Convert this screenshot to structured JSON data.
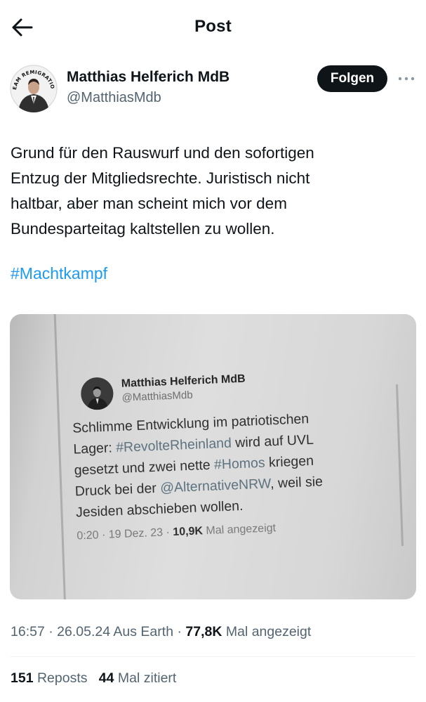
{
  "header": {
    "title": "Post"
  },
  "author": {
    "name": "Matthias Helferich MdB",
    "handle": "@MatthiasMdb",
    "avatar_badge_text": "TEAM REMIGRATION"
  },
  "follow_button": {
    "label": "Folgen"
  },
  "post": {
    "text_lines": [
      "Grund für den Rauswurf und den sofortigen",
      "Entzug der Mitgliedsrechte. Juristisch nicht",
      "haltbar, aber man scheint mich vor dem",
      "Bundesparteitag kaltstellen zu wollen."
    ],
    "hashtag": "#Machtkampf"
  },
  "embedded_photo": {
    "name": "Matthias Helferich MdB",
    "handle": "@MatthiasMdb",
    "lines": [
      [
        "Schlimme Entwicklung im patriotischen"
      ],
      [
        "Lager: ",
        "#RevolteRheinland",
        " wird auf UVL"
      ],
      [
        "gesetzt und zwei nette ",
        "#Homos",
        " kriegen"
      ],
      [
        "Druck bei der ",
        "@AlternativeNRW",
        ", weil sie"
      ],
      [
        "Jesiden abschieben wollen."
      ]
    ],
    "time": "0:20",
    "date": "19 Dez. 23",
    "views": "10,9K",
    "views_label": "Mal angezeigt"
  },
  "meta": {
    "time": "16:57",
    "date": "26.05.24",
    "source": "Aus Earth",
    "views": "77,8K",
    "views_label": "Mal angezeigt"
  },
  "stats": {
    "reposts_count": "151",
    "reposts_label": "Reposts",
    "quotes_count": "44",
    "quotes_label": "Mal zitiert"
  },
  "colors": {
    "accent": "#1d9bf0",
    "text": "#0f1419",
    "secondary": "#536471"
  },
  "icons": {
    "back": "arrow-left-icon",
    "more": "more-horizontal-icon"
  }
}
